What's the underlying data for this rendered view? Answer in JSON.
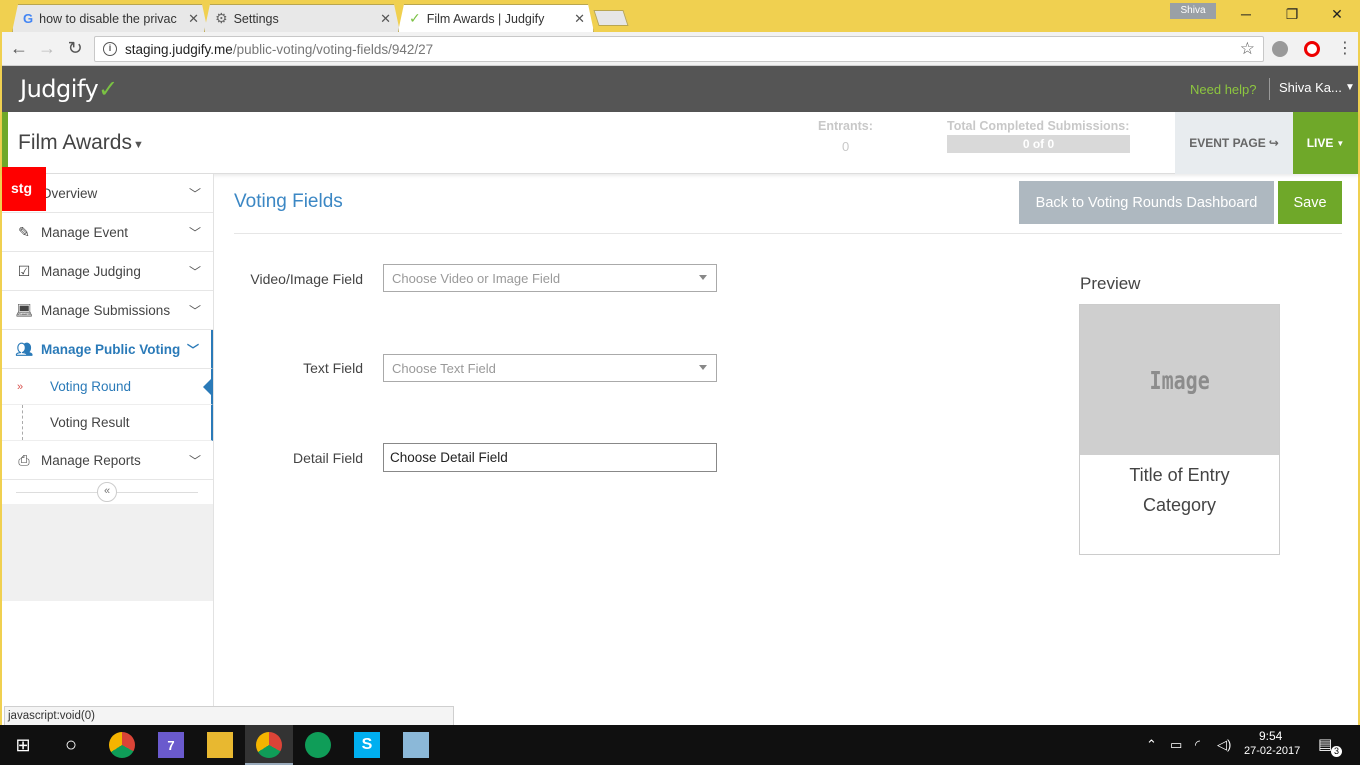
{
  "browser": {
    "tabs": [
      {
        "title": "how to disable the privac",
        "icon": "google-icon"
      },
      {
        "title": "Settings",
        "icon": "gear-icon"
      },
      {
        "title": "Film Awards | Judgify",
        "icon": "judgify-check-icon"
      }
    ],
    "profile_name": "Shiva",
    "url_host": "staging.judgify.me",
    "url_path": "/public-voting/voting-fields/942/27"
  },
  "app": {
    "logo": "Judgify",
    "help_link": "Need help?",
    "user_name": "Shiva Ka..."
  },
  "event": {
    "title": "Film Awards",
    "entrants_label": "Entrants:",
    "entrants_value": "0",
    "submissions_label": "Total Completed Submissions:",
    "submissions_value": "0 of 0",
    "event_page_label": "EVENT PAGE",
    "live_label": "LIVE"
  },
  "sidebar": {
    "badge": "stg",
    "items": [
      {
        "label": "Overview",
        "icon": "overview-icon"
      },
      {
        "label": "Manage Event",
        "icon": "edit-icon"
      },
      {
        "label": "Manage Judging",
        "icon": "checkbox-icon"
      },
      {
        "label": "Manage Submissions",
        "icon": "laptop-icon"
      },
      {
        "label": "Manage Public Voting",
        "icon": "users-icon"
      },
      {
        "label": "Manage Reports",
        "icon": "printer-icon"
      }
    ],
    "sub_items": [
      {
        "label": "Voting Round"
      },
      {
        "label": "Voting Result"
      }
    ]
  },
  "main": {
    "title": "Voting Fields",
    "back_button": "Back to Voting Rounds Dashboard",
    "save_button": "Save",
    "fields": {
      "video_label": "Video/Image Field",
      "video_placeholder": "Choose Video or Image Field",
      "text_label": "Text Field",
      "text_placeholder": "Choose Text Field",
      "detail_label": "Detail Field",
      "detail_value": "Choose Detail Field"
    },
    "preview": {
      "label": "Preview",
      "image_text": "Image",
      "entry_title": "Title of Entry",
      "category": "Category"
    }
  },
  "status_bar": "javascript:void(0)",
  "taskbar": {
    "time": "9:54",
    "date": "27-02-2017",
    "notification_count": "3"
  }
}
